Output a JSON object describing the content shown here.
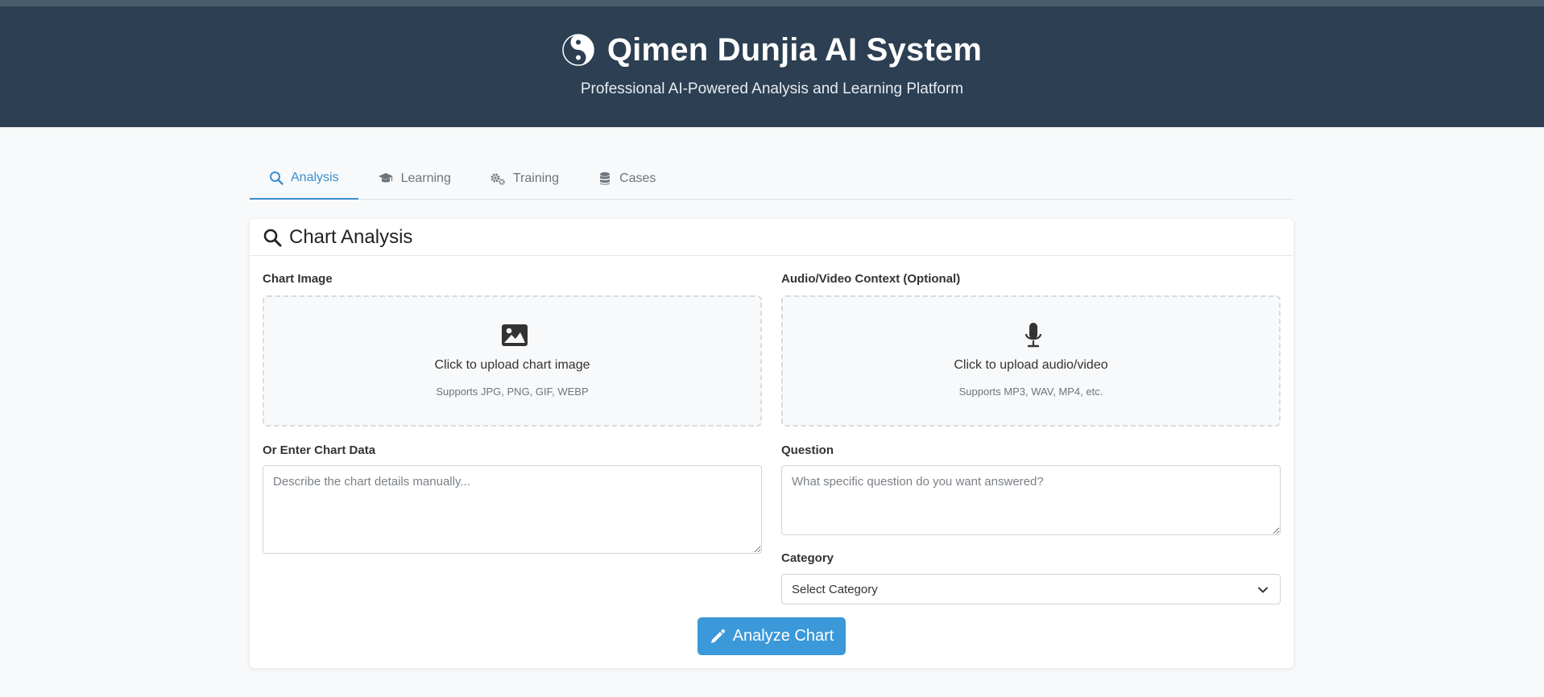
{
  "header": {
    "title": "Qimen Dunjia AI System",
    "subtitle": "Professional AI-Powered Analysis and Learning Platform",
    "logo_icon": "yin-yang-icon"
  },
  "tabs": [
    {
      "label": "Analysis",
      "icon": "search-icon",
      "active": true
    },
    {
      "label": "Learning",
      "icon": "graduation-cap-icon",
      "active": false
    },
    {
      "label": "Training",
      "icon": "gears-icon",
      "active": false
    },
    {
      "label": "Cases",
      "icon": "database-icon",
      "active": false
    }
  ],
  "card": {
    "title": "Chart Analysis",
    "icon": "search-icon"
  },
  "chart_image": {
    "label": "Chart Image",
    "upload_text": "Click to upload chart image",
    "supports": "Supports JPG, PNG, GIF, WEBP",
    "icon": "image-icon"
  },
  "media": {
    "label": "Audio/Video Context (Optional)",
    "upload_text": "Click to upload audio/video",
    "supports": "Supports MP3, WAV, MP4, etc.",
    "icon": "microphone-icon"
  },
  "chart_data_input": {
    "label": "Or Enter Chart Data",
    "placeholder": "Describe the chart details manually...",
    "value": ""
  },
  "question": {
    "label": "Question",
    "placeholder": "What specific question do you want answered?",
    "value": ""
  },
  "category": {
    "label": "Category",
    "selected": "Select Category"
  },
  "submit": {
    "label": "Analyze Chart",
    "icon": "pencil-icon"
  },
  "colors": {
    "header_bg": "#2d3f52",
    "accent": "#3b8fd0",
    "button_bg": "#3b98d9"
  }
}
